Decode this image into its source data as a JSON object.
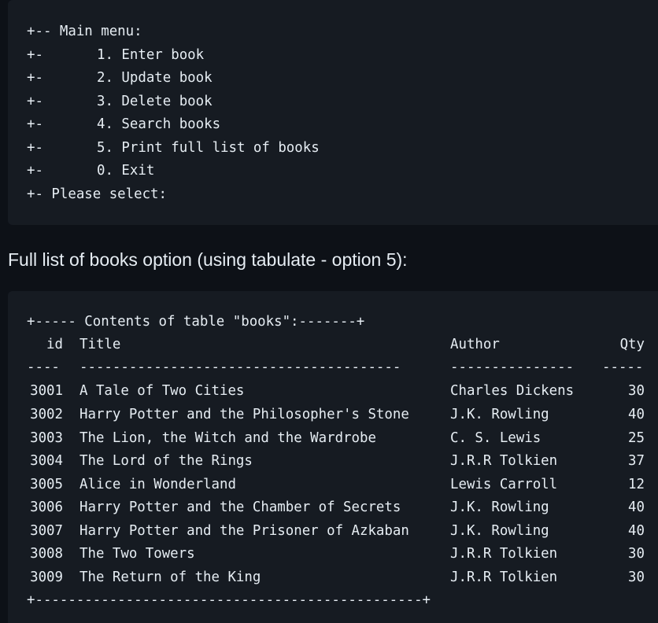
{
  "menu": {
    "header": "+-- Main menu:",
    "prefix": "+-",
    "items": [
      "1. Enter book",
      "2. Update book",
      "3. Delete book",
      "4. Search books",
      "5. Print full list of books",
      "0. Exit"
    ],
    "prompt": "+- Please select:"
  },
  "caption": "Full list of books option (using tabulate - option 5):",
  "table": {
    "top_border": "+----- Contents of table \"books\":-------+",
    "headers": {
      "id": "id",
      "title": "Title",
      "author": "Author",
      "qty": "Qty"
    },
    "separators": {
      "id": "----",
      "title": "---------------------------------------",
      "author": "---------------",
      "qty": "-----"
    },
    "rows": [
      {
        "id": "3001",
        "title": "A Tale of Two Cities",
        "author": "Charles Dickens",
        "qty": "30"
      },
      {
        "id": "3002",
        "title": "Harry Potter and the Philosopher's Stone",
        "author": "J.K. Rowling",
        "qty": "40"
      },
      {
        "id": "3003",
        "title": "The Lion, the Witch and the Wardrobe",
        "author": "C. S. Lewis",
        "qty": "25"
      },
      {
        "id": "3004",
        "title": "The Lord of the Rings",
        "author": "J.R.R Tolkien",
        "qty": "37"
      },
      {
        "id": "3005",
        "title": "Alice in Wonderland",
        "author": "Lewis Carroll",
        "qty": "12"
      },
      {
        "id": "3006",
        "title": "Harry Potter and the Chamber of Secrets",
        "author": "J.K. Rowling",
        "qty": "40"
      },
      {
        "id": "3007",
        "title": "Harry Potter and the Prisoner of Azkaban",
        "author": "J.K. Rowling",
        "qty": "40"
      },
      {
        "id": "3008",
        "title": "The Two Towers",
        "author": "J.R.R Tolkien",
        "qty": "30"
      },
      {
        "id": "3009",
        "title": "The Return of the King",
        "author": "J.R.R Tolkien",
        "qty": "30"
      }
    ],
    "bottom_border": "+-----------------------------------------------+"
  },
  "colors": {
    "page_background": "#0d1117",
    "code_background": "#161b22",
    "text": "#e6edf3"
  }
}
